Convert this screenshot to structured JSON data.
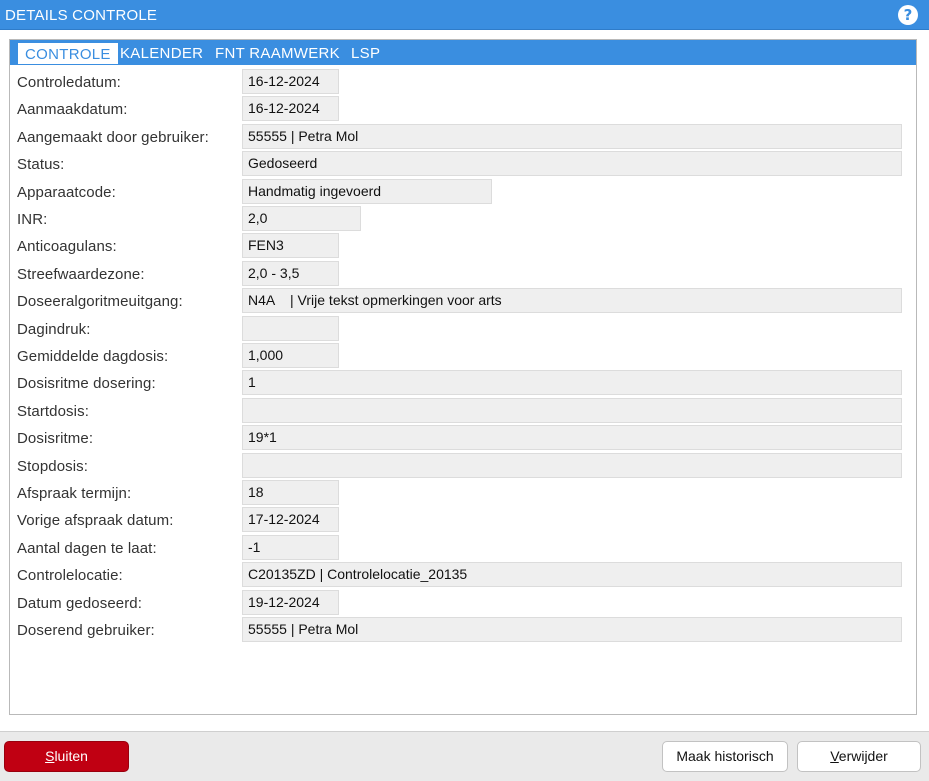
{
  "header": {
    "title": "DETAILS CONTROLE",
    "help_label": "?"
  },
  "tabs": [
    {
      "label": "CONTROLE",
      "active": true
    },
    {
      "label": "KALENDER",
      "active": false
    },
    {
      "label": "FNT RAAMWERK",
      "active": false
    },
    {
      "label": "LSP",
      "active": false
    }
  ],
  "fields": [
    {
      "label": "Controledatum:",
      "value": "16-12-2024"
    },
    {
      "label": "Aanmaakdatum:",
      "value": "16-12-2024"
    },
    {
      "label": "Aangemaakt door gebruiker:",
      "value": "55555 | Petra Mol"
    },
    {
      "label": "Status:",
      "value": "Gedoseerd"
    },
    {
      "label": "Apparaatcode:",
      "value": "Handmatig ingevoerd"
    },
    {
      "label": "INR:",
      "value": "2,0"
    },
    {
      "label": "Anticoagulans:",
      "value": "FEN3"
    },
    {
      "label": "Streefwaardezone:",
      "value": "2,0 - 3,5"
    },
    {
      "label": "Doseeralgoritmeuitgang:",
      "value": "N4A    | Vrije tekst opmerkingen voor arts"
    },
    {
      "label": "Dagindruk:",
      "value": ""
    },
    {
      "label": "Gemiddelde dagdosis:",
      "value": "1,000"
    },
    {
      "label": "Dosisritme dosering:",
      "value": "1"
    },
    {
      "label": "Startdosis:",
      "value": ""
    },
    {
      "label": "Dosisritme:",
      "value": "19*1"
    },
    {
      "label": "Stopdosis:",
      "value": ""
    },
    {
      "label": "Afspraak termijn:",
      "value": "18"
    },
    {
      "label": "Vorige afspraak datum:",
      "value": "17-12-2024"
    },
    {
      "label": "Aantal dagen te laat:",
      "value": "-1"
    },
    {
      "label": "Controlelocatie:",
      "value": "C20135ZD | Controlelocatie_20135"
    },
    {
      "label": "Datum gedoseerd:",
      "value": "19-12-2024"
    },
    {
      "label": "Doserend gebruiker:",
      "value": "55555 | Petra Mol"
    }
  ],
  "footer": {
    "close_first": "S",
    "close_rest": "luiten",
    "historic_label": "Maak historisch",
    "delete_first": "V",
    "delete_rest": "erwijder"
  },
  "colors": {
    "header_bg": "#3a8ee0",
    "close_button_bg": "#c00012",
    "field_bg": "#efefef"
  }
}
